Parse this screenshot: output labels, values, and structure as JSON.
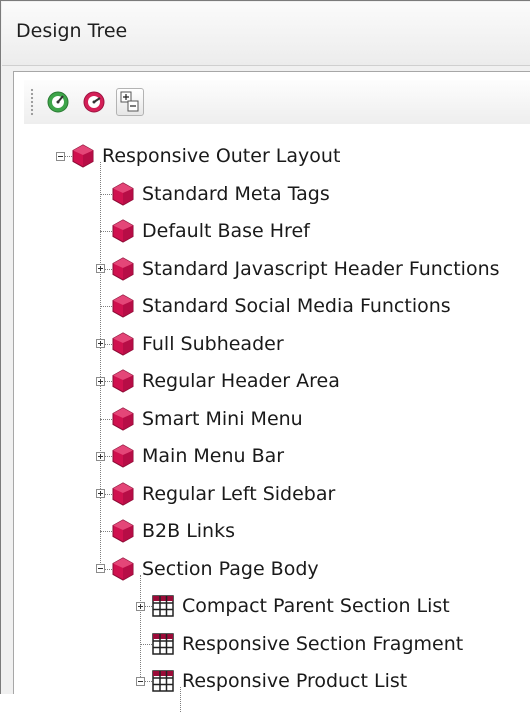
{
  "window": {
    "title": "Design Tree"
  },
  "toolbar": {
    "buttons": [
      {
        "icon": "green-gauge-icon"
      },
      {
        "icon": "red-gauge-icon"
      },
      {
        "icon": "expand-collapse-icon",
        "pressed": true
      }
    ]
  },
  "tree": {
    "nodes": [
      {
        "label": "Responsive Outer Layout",
        "level": 0,
        "icon": "layout-hexagon-icon",
        "expander": "collapse"
      },
      {
        "label": "Standard Meta Tags",
        "level": 1,
        "icon": "layout-hexagon-icon",
        "expander": "none"
      },
      {
        "label": "Default Base Href",
        "level": 1,
        "icon": "layout-hexagon-icon",
        "expander": "none"
      },
      {
        "label": "Standard Javascript Header Functions",
        "level": 1,
        "icon": "layout-hexagon-icon",
        "expander": "expand"
      },
      {
        "label": "Standard Social Media Functions",
        "level": 1,
        "icon": "layout-hexagon-icon",
        "expander": "none"
      },
      {
        "label": "Full Subheader",
        "level": 1,
        "icon": "layout-hexagon-icon",
        "expander": "expand"
      },
      {
        "label": "Regular Header Area",
        "level": 1,
        "icon": "layout-hexagon-icon",
        "expander": "expand"
      },
      {
        "label": "Smart Mini Menu",
        "level": 1,
        "icon": "layout-hexagon-icon",
        "expander": "none"
      },
      {
        "label": "Main Menu Bar",
        "level": 1,
        "icon": "layout-hexagon-icon",
        "expander": "expand"
      },
      {
        "label": "Regular Left Sidebar",
        "level": 1,
        "icon": "layout-hexagon-icon",
        "expander": "expand"
      },
      {
        "label": "B2B Links",
        "level": 1,
        "icon": "layout-hexagon-icon",
        "expander": "none"
      },
      {
        "label": "Section Page Body",
        "level": 1,
        "icon": "layout-hexagon-icon",
        "expander": "collapse"
      },
      {
        "label": "Compact Parent Section List",
        "level": 2,
        "icon": "grid-table-icon",
        "expander": "expand"
      },
      {
        "label": "Responsive Section Fragment",
        "level": 2,
        "icon": "grid-table-icon",
        "expander": "none"
      },
      {
        "label": "Responsive Product List",
        "level": 2,
        "icon": "grid-table-icon",
        "expander": "collapse"
      }
    ]
  },
  "colors": {
    "hexagon": "#d0114f",
    "grid_cell": "#9b0b38",
    "green_gauge": "#3ea54a",
    "red_gauge": "#d41f57"
  }
}
